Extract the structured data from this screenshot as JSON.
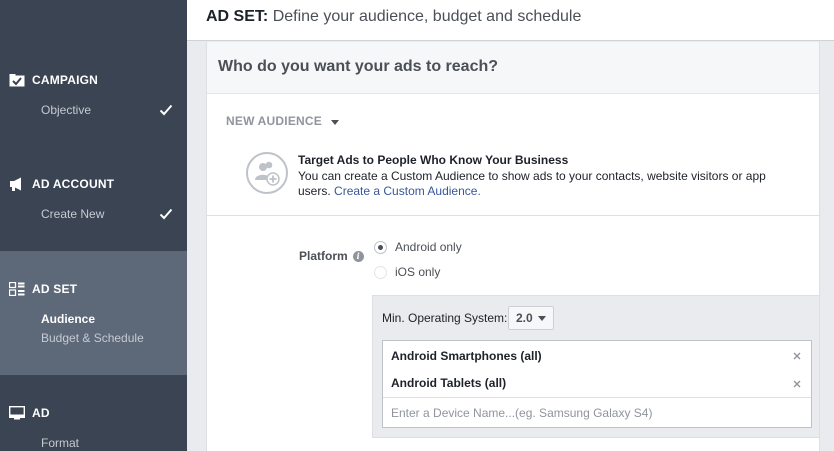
{
  "header": {
    "prefix": "AD SET:",
    "title": "Define your audience, budget and schedule"
  },
  "sidebar": {
    "campaign": {
      "title": "CAMPAIGN",
      "items": [
        {
          "label": "Objective",
          "done": true
        }
      ]
    },
    "ad_account": {
      "title": "AD ACCOUNT",
      "items": [
        {
          "label": "Create New",
          "done": true
        }
      ]
    },
    "ad_set": {
      "title": "AD SET",
      "items": [
        {
          "label": "Audience",
          "active": true
        },
        {
          "label": "Budget & Schedule"
        }
      ]
    },
    "ad": {
      "title": "AD",
      "items": [
        {
          "label": "Format"
        }
      ]
    }
  },
  "main": {
    "question": "Who do you want your ads to reach?",
    "audience_dropdown": "NEW AUDIENCE",
    "custom_audience": {
      "title": "Target Ads to People Who Know Your Business",
      "desc": "You can create a Custom Audience to show ads to your contacts, website visitors or app users.",
      "link": "Create a Custom Audience."
    },
    "platform": {
      "label": "Platform",
      "options": [
        {
          "label": "Android only",
          "selected": true
        },
        {
          "label": "iOS only",
          "selected": false
        }
      ],
      "min_os_label": "Min. Operating System:",
      "min_os_value": "2.0",
      "devices": [
        "Android Smartphones (all)",
        "Android Tablets (all)"
      ],
      "device_placeholder": "Enter a Device Name...(eg. Samsung Galaxy S4)"
    }
  },
  "icons": {
    "campaign": "flag-check-icon",
    "ad_account": "megaphone-icon",
    "ad_set": "grid-icon",
    "ad": "monitor-icon",
    "custom_audience": "people-add-icon",
    "check": "checkmark-icon",
    "remove": "close-icon",
    "info": "info-icon"
  },
  "colors": {
    "sidebar": "#3b4452",
    "sidebar_active": "#5d6879",
    "link": "#365899"
  }
}
